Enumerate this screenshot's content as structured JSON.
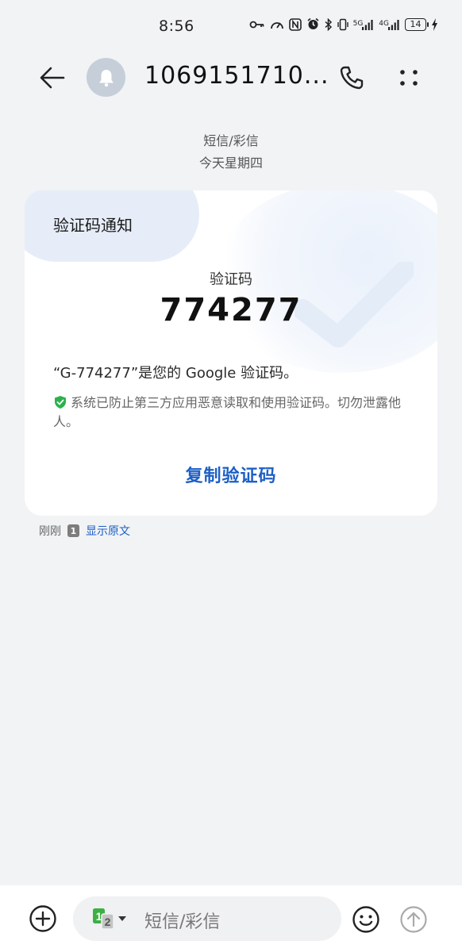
{
  "status_bar": {
    "time": "8:56",
    "network_1": "5G",
    "network_2": "4G",
    "battery": "14"
  },
  "header": {
    "contact": "1069151710..."
  },
  "thread": {
    "channel": "短信/彩信",
    "date": "今天星期四"
  },
  "card": {
    "title": "验证码通知",
    "code_label": "验证码",
    "code": "774277",
    "body": "“G-774277”是您的 Google 验证码。",
    "security_note": "系统已防止第三方应用恶意读取和使用验证码。切勿泄露他人。",
    "copy_label": "复制验证码"
  },
  "message_footer": {
    "time": "刚刚",
    "sim": "1",
    "show_original": "显示原文"
  },
  "composer": {
    "placeholder": "短信/彩信",
    "sim_1": "1",
    "sim_2": "2"
  },
  "colors": {
    "accent": "#1d5fc6",
    "background": "#f1f3f5",
    "shield": "#2bb24c",
    "sim_green": "#3cb043"
  }
}
